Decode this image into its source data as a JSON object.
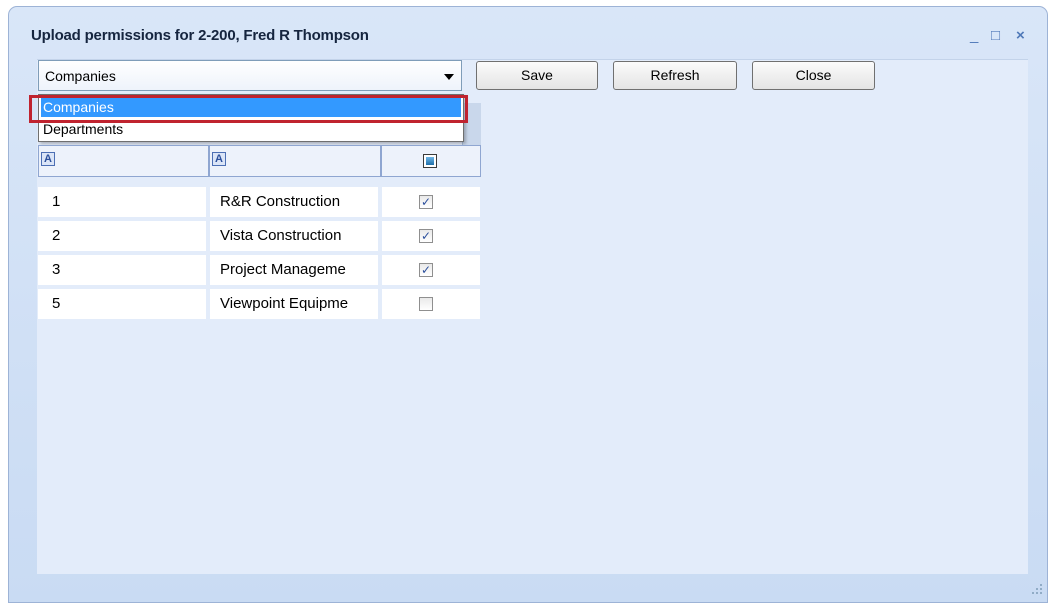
{
  "window": {
    "title": "Upload permissions for 2-200, Fred R Thompson",
    "minimize_glyph": "_",
    "maximize_glyph": "□",
    "close_glyph": "×"
  },
  "toolbar": {
    "combo_value": "Companies",
    "save_label": "Save",
    "refresh_label": "Refresh",
    "close_label": "Close"
  },
  "dropdown": {
    "options": [
      "Companies",
      "Departments"
    ],
    "selected": "Companies"
  },
  "grid": {
    "filter_icons": [
      "text-filter-icon",
      "text-filter-icon",
      "checkbox-filter-icon"
    ],
    "rows": [
      {
        "id": "1",
        "name": "R&R Construction",
        "checked": true,
        "check_glyph": "✓"
      },
      {
        "id": "2",
        "name": "Vista Construction",
        "checked": true,
        "check_glyph": "✓"
      },
      {
        "id": "3",
        "name": "Project Manageme",
        "checked": true,
        "check_glyph": "✓"
      },
      {
        "id": "5",
        "name": "Viewpoint Equipme",
        "checked": false,
        "check_glyph": ""
      }
    ]
  },
  "colors": {
    "highlight": "#3399ff",
    "annotation_box": "#c0232f",
    "client_bg": "#e3ecfa"
  }
}
